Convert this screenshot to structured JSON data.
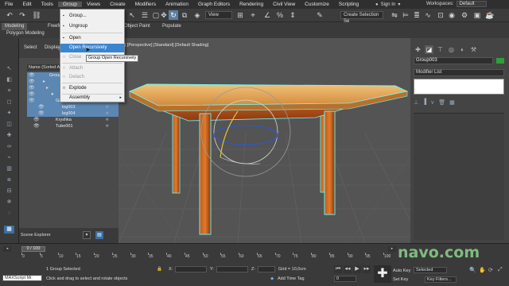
{
  "menubar": {
    "items": [
      "File",
      "Edit",
      "Tools",
      "Group",
      "Views",
      "Create",
      "Modifiers",
      "Animation",
      "Graph Editors",
      "Rendering",
      "Civil View",
      "Customize",
      "Scripting"
    ],
    "sign_in": "Sign In",
    "workspaces_label": "Workspaces:",
    "workspace_value": "Default"
  },
  "toolbar": {
    "view_dropdown": "View",
    "selection_set_placeholder": "Create Selection Se"
  },
  "ribbon": {
    "tabs": [
      "Modeling",
      "Freefo"
    ],
    "subtab": "Polygon Modeling",
    "object_paint": "Object Paint",
    "populate": "Populate"
  },
  "explorer": {
    "tabs": [
      "Select",
      "Display"
    ],
    "header": "Name (Sorted A",
    "rows": [
      {
        "label": "Group003",
        "depth": 0,
        "selected": true
      },
      {
        "label": "",
        "depth": 1,
        "selected": true
      },
      {
        "label": "",
        "depth": 1,
        "selected": true
      },
      {
        "label": "",
        "depth": 2,
        "selected": true
      },
      {
        "label": "Group002",
        "depth": 1,
        "selected": true
      },
      {
        "label": "leg003",
        "depth": 2,
        "selected": true
      },
      {
        "label": "leg004",
        "depth": 2,
        "selected": true
      },
      {
        "label": "Kryshka",
        "depth": 0,
        "selected": false
      },
      {
        "label": "Tube001",
        "depth": 0,
        "selected": false
      }
    ],
    "scene_explorer": "Scene Explorer"
  },
  "group_menu": {
    "items": [
      {
        "label": "Group...",
        "enabled": true,
        "highlight": false,
        "icon": "bullet"
      },
      {
        "label": "Ungroup",
        "enabled": true,
        "highlight": false,
        "icon": "bullet"
      },
      {
        "label": "Open",
        "enabled": true,
        "highlight": false,
        "icon": "bullet"
      },
      {
        "label": "Open Recursively",
        "enabled": true,
        "highlight": true,
        "icon": ""
      },
      {
        "label": "Close",
        "enabled": false,
        "highlight": false,
        "icon": "square"
      },
      {
        "label": "Attach",
        "enabled": false,
        "highlight": false,
        "icon": "square"
      },
      {
        "label": "Detach",
        "enabled": false,
        "highlight": false,
        "icon": "square"
      },
      {
        "label": "Explode",
        "enabled": true,
        "highlight": false,
        "icon": "square"
      },
      {
        "label": "Assembly",
        "enabled": true,
        "highlight": false,
        "icon": "",
        "submenu": true
      }
    ],
    "tooltip": "Group Open Recursively"
  },
  "viewport": {
    "label": "[+] [Perspective] [Standard] [Default Shading]"
  },
  "command_panel": {
    "object_name": "Group003",
    "object_color": "#2f9e3a",
    "modifier_list": "Modifier List"
  },
  "timeline": {
    "slider": "0 / 100",
    "ticks": [
      "0",
      "5",
      "10",
      "15",
      "20",
      "25",
      "30",
      "35",
      "40",
      "45",
      "50",
      "55",
      "60",
      "65",
      "70",
      "75",
      "80",
      "85",
      "90",
      "95",
      "100"
    ]
  },
  "statusbar": {
    "maxscript": "MAXScript Mi:",
    "selection": "1 Group Selected",
    "prompt": "Click and drag to select and rotate objects",
    "x_label": "X:",
    "y_label": "Y:",
    "z_label": "Z:",
    "grid": "Grid = 10,0cm",
    "add_time_tag": "Add Time Tag",
    "auto_key": "Auto Key",
    "selected": "Selected",
    "set_key": "Set Key",
    "key_filters": "Key Filters...",
    "frame": "0"
  },
  "watermark": "navo.com"
}
